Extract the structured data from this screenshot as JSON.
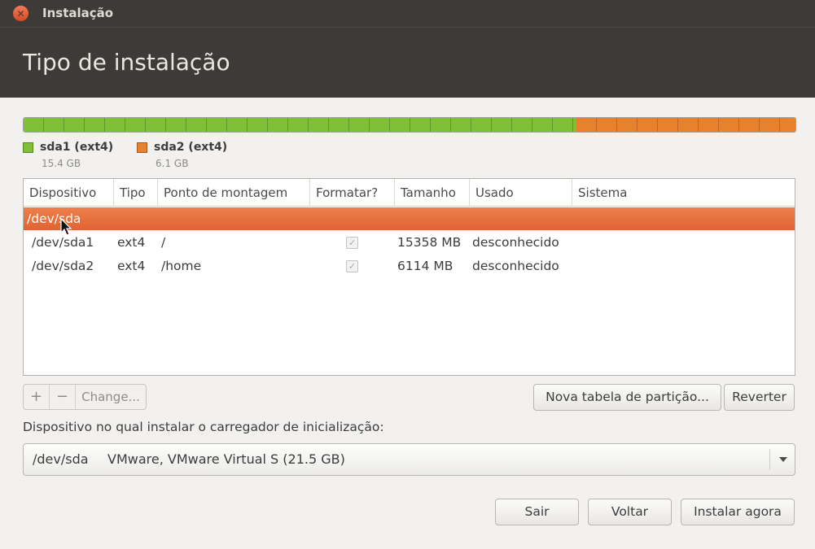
{
  "window": {
    "title": "Instalação"
  },
  "header": {
    "title": "Tipo de instalação"
  },
  "colors": {
    "sda1": "#7fc036",
    "sda2": "#e8812c",
    "selection": "#e66f3a"
  },
  "partition_bar": {
    "segments": [
      {
        "name": "sda1",
        "fraction": 0.716
      },
      {
        "name": "sda2",
        "fraction": 0.284
      }
    ]
  },
  "legend": [
    {
      "name": "sda1 (ext4)",
      "size": "15.4 GB"
    },
    {
      "name": "sda2 (ext4)",
      "size": "6.1 GB"
    }
  ],
  "table": {
    "columns": [
      "Dispositivo",
      "Tipo",
      "Ponto de montagem",
      "Formatar?",
      "Tamanho",
      "Usado",
      "Sistema"
    ],
    "device_row": {
      "device": "/dev/sda"
    },
    "rows": [
      {
        "device": "/dev/sda1",
        "type": "ext4",
        "mount": "/",
        "format": true,
        "size": "15358 MB",
        "used": "desconhecido",
        "system": ""
      },
      {
        "device": "/dev/sda2",
        "type": "ext4",
        "mount": "/home",
        "format": true,
        "size": "6114 MB",
        "used": "desconhecido",
        "system": ""
      }
    ]
  },
  "table_controls": {
    "add": "+",
    "remove": "−",
    "change": "Change..."
  },
  "buttons": {
    "new_table": "Nova tabela de partição...",
    "revert": "Reverter",
    "quit": "Sair",
    "back": "Voltar",
    "install": "Instalar agora"
  },
  "bootloader": {
    "label": "Dispositivo no qual instalar o carregador de inicialização:",
    "device": "/dev/sda",
    "description": "VMware, VMware Virtual S (21.5 GB)"
  },
  "icons": {
    "close": "close-icon",
    "dropdown": "chevron-down-icon",
    "cursor": "mouse-pointer-icon",
    "check": "checkmark-icon"
  }
}
